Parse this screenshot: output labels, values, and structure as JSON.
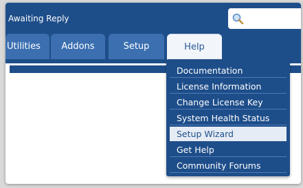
{
  "header": {
    "status_text": "Awaiting Reply",
    "search": {
      "placeholder": "",
      "icon": "search-icon"
    }
  },
  "nav": {
    "tabs": [
      {
        "label": "Utilities",
        "active": false
      },
      {
        "label": "Addons",
        "active": false
      },
      {
        "label": "Setup",
        "active": false
      },
      {
        "label": "Help",
        "active": true
      }
    ]
  },
  "help_menu": {
    "items": [
      {
        "label": "Documentation"
      },
      {
        "label": "License Information"
      },
      {
        "label": "Change License Key"
      },
      {
        "label": "System Health Status"
      },
      {
        "label": "Setup Wizard",
        "highlighted": true
      },
      {
        "label": "Get Help"
      },
      {
        "label": "Community Forums"
      }
    ]
  },
  "colors": {
    "primary": "#1e4e8a",
    "tab": "#3b6fb0",
    "highlight": "#e6ecf5"
  }
}
